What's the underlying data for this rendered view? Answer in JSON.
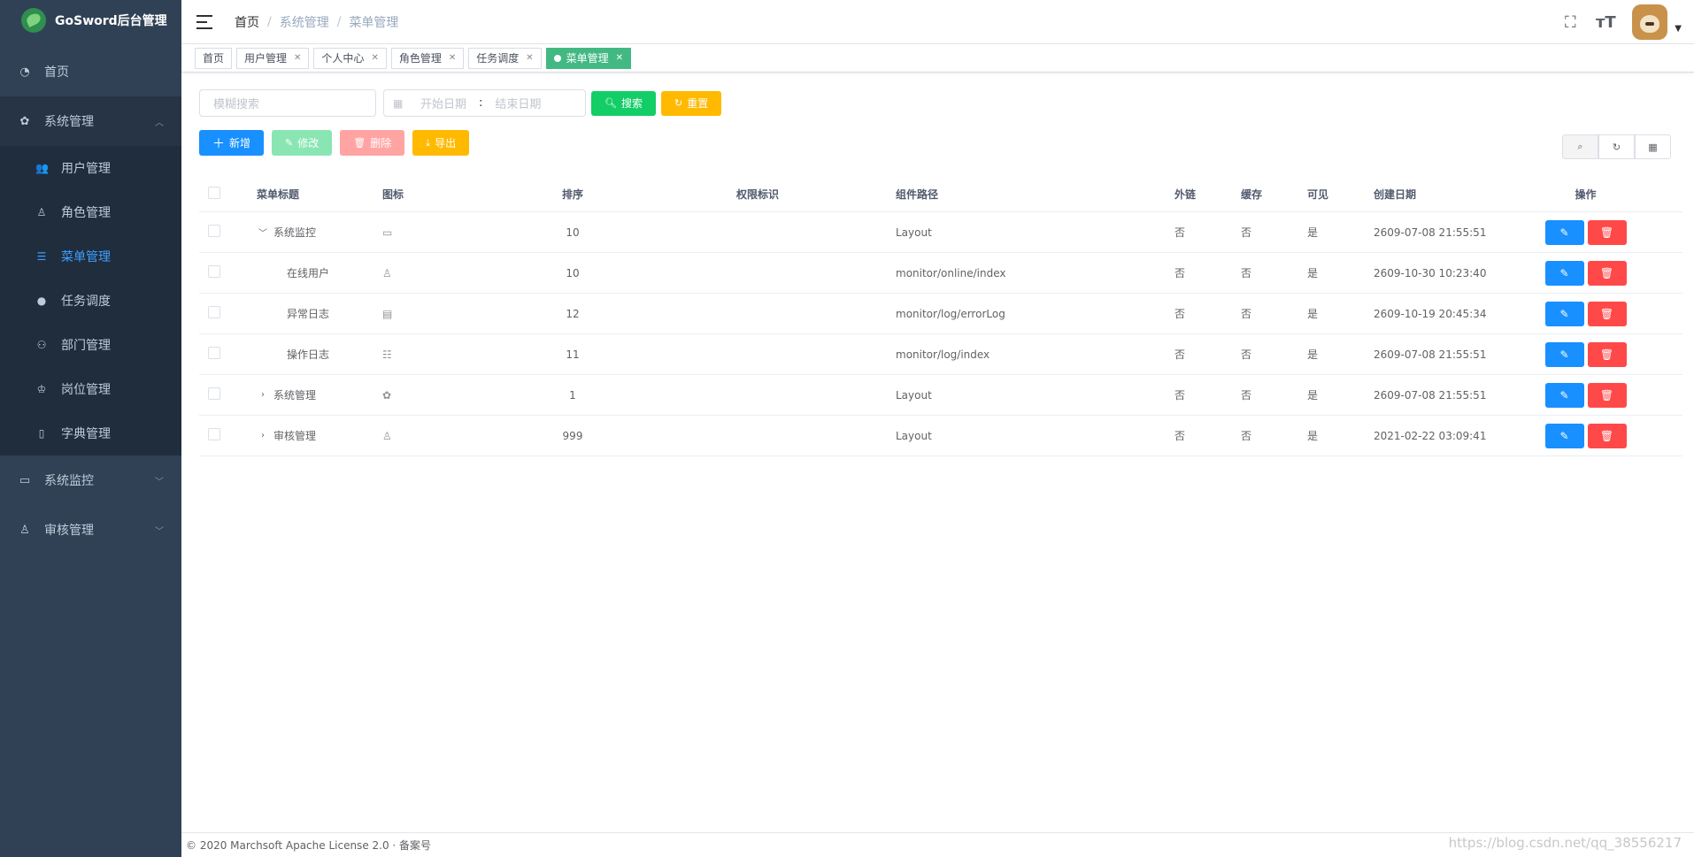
{
  "app": {
    "title": "GoSword后台管理"
  },
  "sidebar": {
    "items": [
      {
        "label": "首页",
        "icon": "dashboard-icon"
      },
      {
        "label": "系统管理",
        "icon": "gear-icon",
        "expanded": true,
        "children": [
          {
            "label": "用户管理",
            "icon": "user-icon"
          },
          {
            "label": "角色管理",
            "icon": "role-icon"
          },
          {
            "label": "菜单管理",
            "icon": "menu-icon",
            "active": true
          },
          {
            "label": "任务调度",
            "icon": "job-icon"
          },
          {
            "label": "部门管理",
            "icon": "dept-icon"
          },
          {
            "label": "岗位管理",
            "icon": "post-icon"
          },
          {
            "label": "字典管理",
            "icon": "dict-icon"
          }
        ]
      },
      {
        "label": "系统监控",
        "icon": "monitor-icon"
      },
      {
        "label": "审核管理",
        "icon": "audit-icon"
      }
    ]
  },
  "header": {
    "breadcrumb": [
      "首页",
      "系统管理",
      "菜单管理"
    ]
  },
  "tags": [
    {
      "label": "首页",
      "closable": false
    },
    {
      "label": "用户管理",
      "closable": true
    },
    {
      "label": "个人中心",
      "closable": true
    },
    {
      "label": "角色管理",
      "closable": true
    },
    {
      "label": "任务调度",
      "closable": true
    },
    {
      "label": "菜单管理",
      "closable": true,
      "active": true
    }
  ],
  "search": {
    "placeholder": "模糊搜索",
    "start_placeholder": "开始日期",
    "range_separator": ":",
    "end_placeholder": "结束日期",
    "search_label": "搜索",
    "reset_label": "重置"
  },
  "toolbar": {
    "add_label": "新增",
    "edit_label": "修改",
    "delete_label": "删除",
    "export_label": "导出"
  },
  "table": {
    "columns": [
      "菜单标题",
      "图标",
      "排序",
      "权限标识",
      "组件路径",
      "外链",
      "缓存",
      "可见",
      "创建日期",
      "操作"
    ],
    "rows": [
      {
        "title": "系统监控",
        "level": 0,
        "expand": "open",
        "icon": "monitor-icon",
        "sort": "10",
        "perm": "",
        "path": "Layout",
        "ilink": "否",
        "cache": "否",
        "visible": "是",
        "date": "2609-07-08 21:55:51"
      },
      {
        "title": "在线用户",
        "level": 1,
        "expand": "",
        "icon": "online-icon",
        "sort": "10",
        "perm": "",
        "path": "monitor/online/index",
        "ilink": "否",
        "cache": "否",
        "visible": "是",
        "date": "2609-10-30 10:23:40"
      },
      {
        "title": "异常日志",
        "level": 1,
        "expand": "",
        "icon": "error-icon",
        "sort": "12",
        "perm": "",
        "path": "monitor/log/errorLog",
        "ilink": "否",
        "cache": "否",
        "visible": "是",
        "date": "2609-10-19 20:45:34"
      },
      {
        "title": "操作日志",
        "level": 1,
        "expand": "",
        "icon": "log-icon",
        "sort": "11",
        "perm": "",
        "path": "monitor/log/index",
        "ilink": "否",
        "cache": "否",
        "visible": "是",
        "date": "2609-07-08 21:55:51"
      },
      {
        "title": "系统管理",
        "level": 0,
        "expand": "closed",
        "icon": "gear-icon",
        "sort": "1",
        "perm": "",
        "path": "Layout",
        "ilink": "否",
        "cache": "否",
        "visible": "是",
        "date": "2609-07-08 21:55:51"
      },
      {
        "title": "审核管理",
        "level": 0,
        "expand": "closed",
        "icon": "audit-icon",
        "sort": "999",
        "perm": "",
        "path": "Layout",
        "ilink": "否",
        "cache": "否",
        "visible": "是",
        "date": "2021-02-22 03:09:41"
      }
    ]
  },
  "footer": {
    "text": "© 2020 Marchsoft Apache License 2.0 · 备案号",
    "watermark": "https://blog.csdn.net/qq_38556217"
  },
  "colors": {
    "sidebar_bg": "#304156",
    "submenu_bg": "#1f2d3d",
    "accent": "#409eff",
    "tag_active": "#42b983",
    "success": "#13ce66",
    "warning": "#ffba00",
    "primary": "#1890ff",
    "danger": "#ff4949"
  }
}
